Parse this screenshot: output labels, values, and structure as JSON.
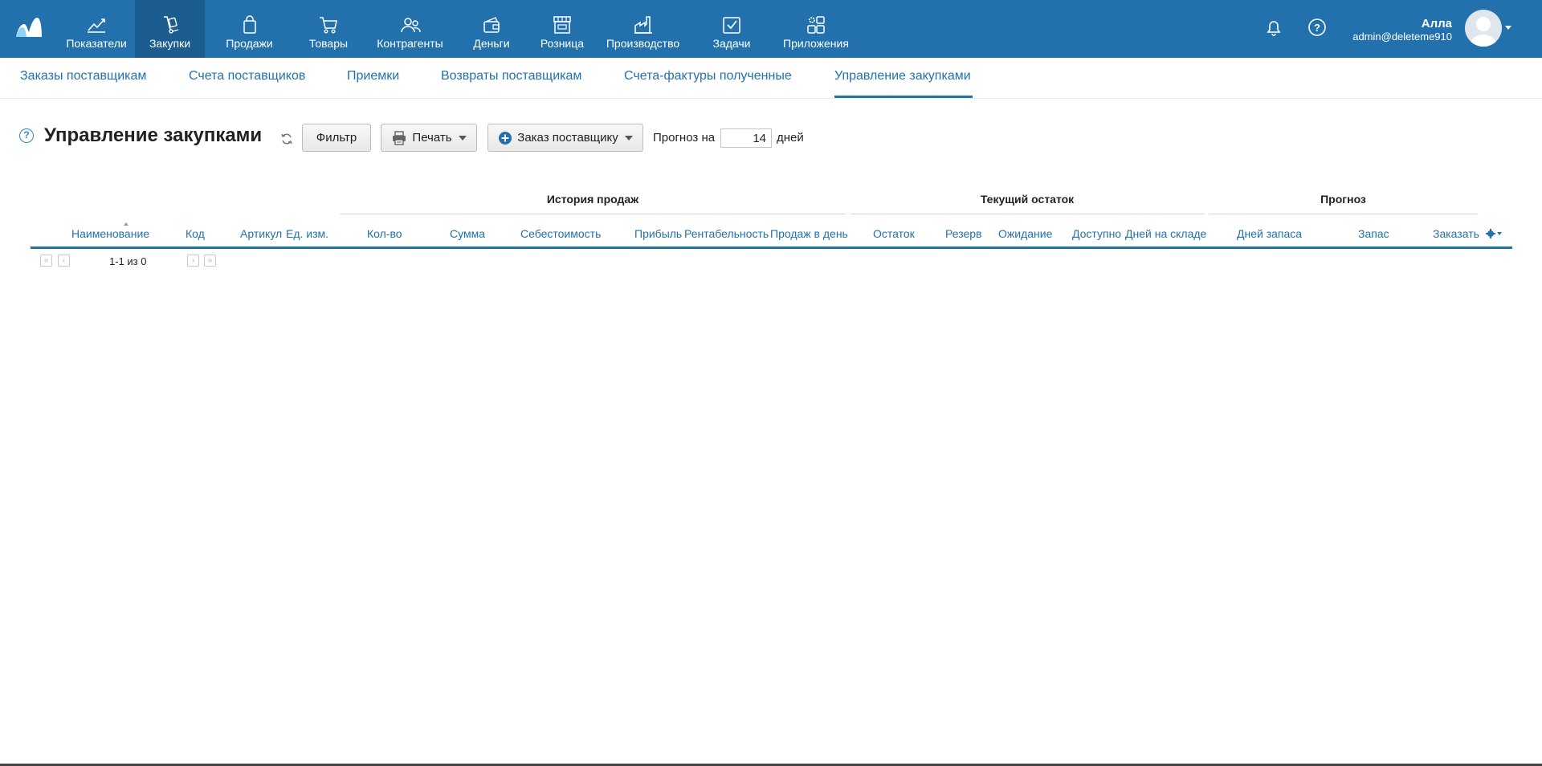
{
  "nav": {
    "items": [
      {
        "label": "Показатели",
        "icon": "chart-line-icon"
      },
      {
        "label": "Закупки",
        "icon": "cart-dolly-icon"
      },
      {
        "label": "Продажи",
        "icon": "shopping-bag-icon"
      },
      {
        "label": "Товары",
        "icon": "shopping-cart-icon"
      },
      {
        "label": "Контрагенты",
        "icon": "people-icon"
      },
      {
        "label": "Деньги",
        "icon": "wallet-icon"
      },
      {
        "label": "Розница",
        "icon": "storefront-icon"
      },
      {
        "label": "Производство",
        "icon": "factory-icon"
      },
      {
        "label": "Задачи",
        "icon": "checkbox-icon"
      },
      {
        "label": "Приложения",
        "icon": "apps-grid-icon"
      }
    ],
    "active": "Закупки"
  },
  "user": {
    "name": "Алла",
    "email": "admin@deleteme910"
  },
  "subnav": {
    "items": [
      "Заказы поставщикам",
      "Счета поставщиков",
      "Приемки",
      "Возвраты поставщикам",
      "Счета-фактуры полученные",
      "Управление закупками"
    ],
    "active": "Управление закупками"
  },
  "toolbar": {
    "help": "?",
    "title": "Управление закупками",
    "filter_label": "Фильтр",
    "print_label": "Печать",
    "order_label": "Заказ поставщику",
    "forecast_label": "Прогноз на",
    "forecast_days": "14",
    "forecast_unit": "дней"
  },
  "table": {
    "groups": {
      "sales_history": "История продаж",
      "current_stock": "Текущий остаток",
      "forecast": "Прогноз"
    },
    "columns": [
      "Наименование",
      "Код",
      "Артикул",
      "Ед. изм.",
      "Кол-во",
      "Сумма",
      "Себестоимость",
      "Прибыль",
      "Рентабельность",
      "Продаж в день",
      "Остаток",
      "Резерв",
      "Ожидание",
      "Доступно",
      "Дней на складе",
      "Дней запаса",
      "Запас",
      "Заказать"
    ],
    "sort_column": "Наименование"
  },
  "pagination": {
    "text": "1-1 из 0",
    "first": "«",
    "prev": "‹",
    "next": "›",
    "last": "»"
  },
  "colors": {
    "topbar": "#2271ac",
    "topbar_active": "#1b5d8f",
    "link": "#2271ac"
  }
}
